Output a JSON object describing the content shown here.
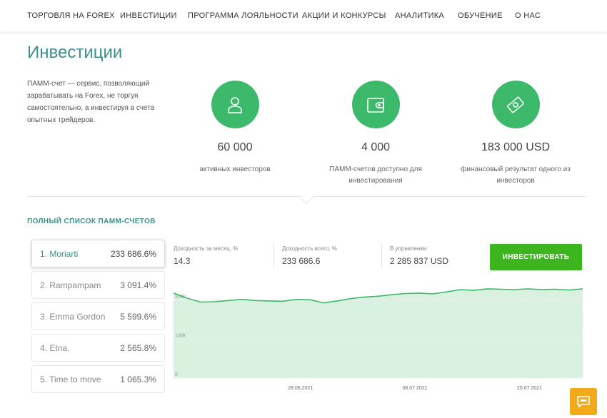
{
  "nav": [
    "Торговля на Forex",
    "Инвестиции",
    "Программа лояльности",
    "Акции и конкурсы",
    "Аналитика",
    "Обучение",
    "О нас"
  ],
  "page": {
    "title": "Инвестиции",
    "intro": "ПАММ-счет — сервис, позволяющий зарабатывать на Forex, не торгуя самостоятельно, а инвестируя в счета опытных трейдеров."
  },
  "stats": [
    {
      "icon": "user-icon",
      "value": "60 000",
      "label": "активных инвесторов"
    },
    {
      "icon": "wallet-icon",
      "value": "4 000",
      "label": "ПАММ-счетов доступно для инвестирования"
    },
    {
      "icon": "money-icon",
      "value": "183 000 USD",
      "label": "финансовый результат одного из инвесторов"
    }
  ],
  "section_title": "ПОЛНЫЙ СПИСОК ПАММ-СЧЕТОВ",
  "accounts": [
    {
      "name": "1. Moriarti",
      "value": "233 686.6%",
      "active": true
    },
    {
      "name": "2. Rampampam",
      "value": "3 091.4%",
      "active": false
    },
    {
      "name": "3. Emma Gordon",
      "value": "5 599.6%",
      "active": false
    },
    {
      "name": "4. Etna.",
      "value": "2 565.8%",
      "active": false
    },
    {
      "name": "5. Time to move",
      "value": "1 065.3%",
      "active": false
    }
  ],
  "metrics": [
    {
      "label": "Доходность за месяц, %",
      "value": "14.3"
    },
    {
      "label": "Доходность всего, %",
      "value": "233 686.6"
    },
    {
      "label": "В управлении",
      "value": "2 285 837 USD"
    }
  ],
  "invest_button": "ИНВЕСТИРОВАТЬ",
  "colors": {
    "accent": "#3e8f8a",
    "green": "#3cb96a",
    "button": "#3cb51e",
    "chat": "#f2a91c"
  },
  "chart_data": {
    "type": "area",
    "y_ticks": [
      "0",
      "100k",
      "200k"
    ],
    "ylim": [
      0,
      260000
    ],
    "x_ticks": [
      "28.06.2021",
      "08.07.2021",
      "20.07.2021"
    ],
    "values": [
      218000,
      205000,
      195000,
      196000,
      199000,
      202000,
      199000,
      198000,
      197000,
      202000,
      201000,
      193000,
      198000,
      204000,
      208000,
      210000,
      214000,
      217000,
      218000,
      216000,
      221000,
      227000,
      225000,
      229000,
      228000,
      227000,
      229000,
      227000,
      228000,
      226000,
      229000
    ]
  }
}
